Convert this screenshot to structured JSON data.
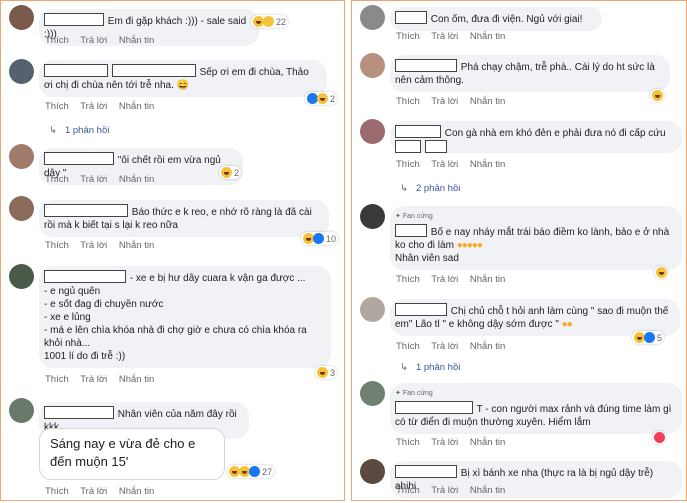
{
  "actions": {
    "like": "Thích",
    "reply": "Trả lời",
    "message": "Nhắn tin"
  },
  "left": {
    "comments": [
      {
        "text": "Em đi gặp khách :))) - sale said :)))",
        "count": "22"
      },
      {
        "text": "Sếp ơi em đi chùa, Thảo ơi chị đi chùa nên tới trễ nha. 😄",
        "count": "2",
        "replies": "1 phản hồi"
      },
      {
        "text": "\"ôi chết rồi em vừa ngủ dậy \"",
        "count": "2"
      },
      {
        "text": "Báo thức e k reo, e nhớ rõ ràng là đã cài rồi mà k biết tại s lại k reo nữa",
        "count": "10"
      },
      {
        "text": "- xe e bị hư dây cuara k vận ga được ...",
        "lines": [
          "- e ngủ quên",
          "- e sốt đag đi chuyền nước",
          "- xe e lủng",
          "- má e lên chìa khóa nhà đi chợ giờ e chưa có chìa khóa ra khỏi nhà...",
          "1001 lí do đi trễ :))"
        ],
        "count": "3"
      },
      {
        "text": "Nhân viên của năm đây rồi kkk",
        "quote": "Sáng nay e vừa đẻ cho e đến muộn 15'",
        "count": "27"
      }
    ]
  },
  "right": {
    "comments": [
      {
        "text": "Con ốm, đưa đi viện. Ngủ với giai!"
      },
      {
        "text": "Phá chạy chậm, trễ phà.. Cái lý do ht sức là nên cảm thông.",
        "count": ""
      },
      {
        "text": "Con gà nhà em khó đẻn e phải đưa nó đi cấp cứu",
        "replies": "2 phản hồi"
      },
      {
        "badge": "Fan cứng",
        "text": "Bố e nay nháy mắt trái báo điềm ko lành, bảo e ở nhà ko cho đi làm",
        "line2": "Nhân viên sad",
        "count": ""
      },
      {
        "text": "Chị chủ chỗ t hỏi anh làm cùng \" sao đi muộn thế em\" Lão tl \" e không dậy sớm được \"",
        "count": "5",
        "replies": "1 phản hồi"
      },
      {
        "badge": "Fan cứng",
        "text": "T - con người max rảnh và đúng time làm gì có từ điển đi muộn thường xuyên. Hiểm lắm"
      },
      {
        "text": "Bị xì bánh xe nha (thực ra là bị ngủ dậy trễ) ahihi"
      }
    ]
  },
  "colors": {
    "accent": "#f0a470",
    "link": "#385898",
    "bubble": "#f0f2f5"
  }
}
